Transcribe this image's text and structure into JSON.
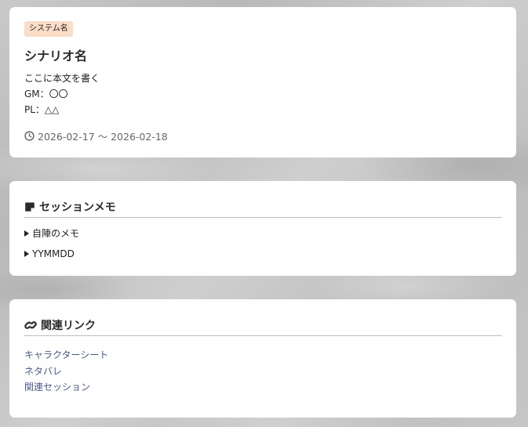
{
  "scenario": {
    "system_badge": "システム名",
    "title": "シナリオ名",
    "body_lines": [
      "ここに本文を書く",
      "GM：〇〇",
      "PL：△△"
    ],
    "date_range": "2026-02-17 ～ 2026-02-18",
    "clock_icon": "clock-icon"
  },
  "memo": {
    "icon": "sticky-note-icon",
    "title": "セッションメモ",
    "items": [
      {
        "label": "自陣のメモ"
      },
      {
        "label": "YYMMDD"
      }
    ]
  },
  "links": {
    "icon": "link-icon",
    "title": "関連リンク",
    "items": [
      {
        "label": "キャラクターシート"
      },
      {
        "label": "ネタバレ"
      },
      {
        "label": "関連セッション"
      }
    ],
    "link_color": "#4b5a8a"
  },
  "colors": {
    "badge_bg": "#fbdcc6",
    "card_bg": "#ffffff",
    "divider": "#bdbdbd"
  }
}
